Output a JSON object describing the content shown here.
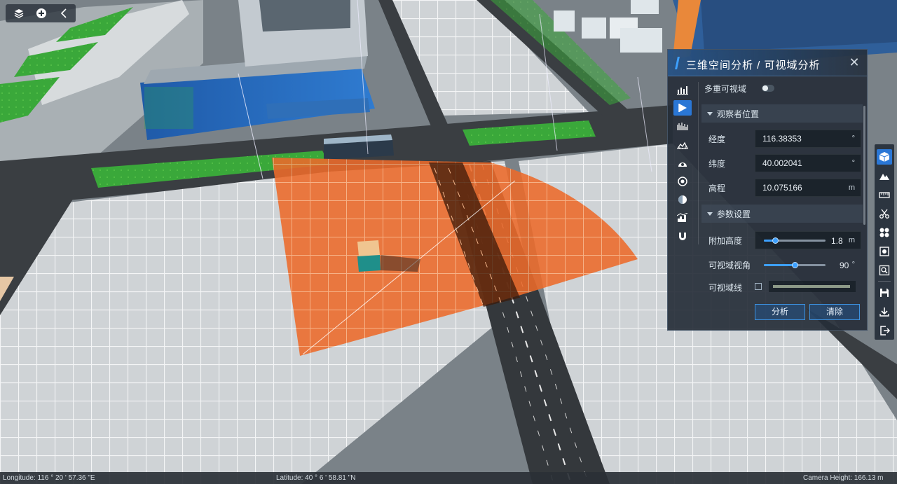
{
  "toolbar": {
    "icons": [
      "layers-icon",
      "add-icon",
      "collapse-icon"
    ]
  },
  "panel": {
    "title": "三维空间分析 / 可视域分析",
    "close_icon": "close-icon",
    "tabs": [
      "bar-chart-icon",
      "viewshed-icon",
      "histogram-icon",
      "terrain-profile-icon",
      "dome-icon",
      "target-icon",
      "sphere-icon",
      "skyline-icon",
      "magnet-icon"
    ],
    "multi_viewshed_label": "多重可视域",
    "multi_viewshed_on": false,
    "observer_section": "观察者位置",
    "longitude_label": "经度",
    "longitude_value": "116.38353",
    "longitude_unit": "°",
    "latitude_label": "纬度",
    "latitude_value": "40.002041",
    "latitude_unit": "°",
    "elevation_label": "高程",
    "elevation_value": "10.075166",
    "elevation_unit": "m",
    "params_section": "参数设置",
    "extra_height_label": "附加高度",
    "extra_height_value": "1.8",
    "extra_height_unit": "m",
    "extra_height_level": 0.18,
    "view_angle_label": "可视域视角",
    "view_angle_value": "90",
    "view_angle_unit": "°",
    "view_angle_level": 0.5,
    "view_line_label": "可视域线",
    "view_line_checked": false,
    "view_line_color": "#8d9a88",
    "analyze_label": "分析",
    "clear_label": "清除"
  },
  "right_tools": [
    "cube-icon",
    "mountain-icon",
    "ruler-icon",
    "scissors-icon",
    "grid-icon",
    "settings-cube-icon",
    "zoom-box-icon",
    "save-icon",
    "download-icon",
    "exit-icon"
  ],
  "status": {
    "longitude": "Longitude:  116 ° 20 ' 57.36 \"E",
    "latitude": "Latitude:  40 ° 6 ' 58.81 \"N",
    "camera_height": "Camera Height:    166.13 m"
  },
  "colors": {
    "accent": "#2a77d6",
    "viewshed_visible": "#f06a26",
    "panel_bg": "#262e38"
  }
}
